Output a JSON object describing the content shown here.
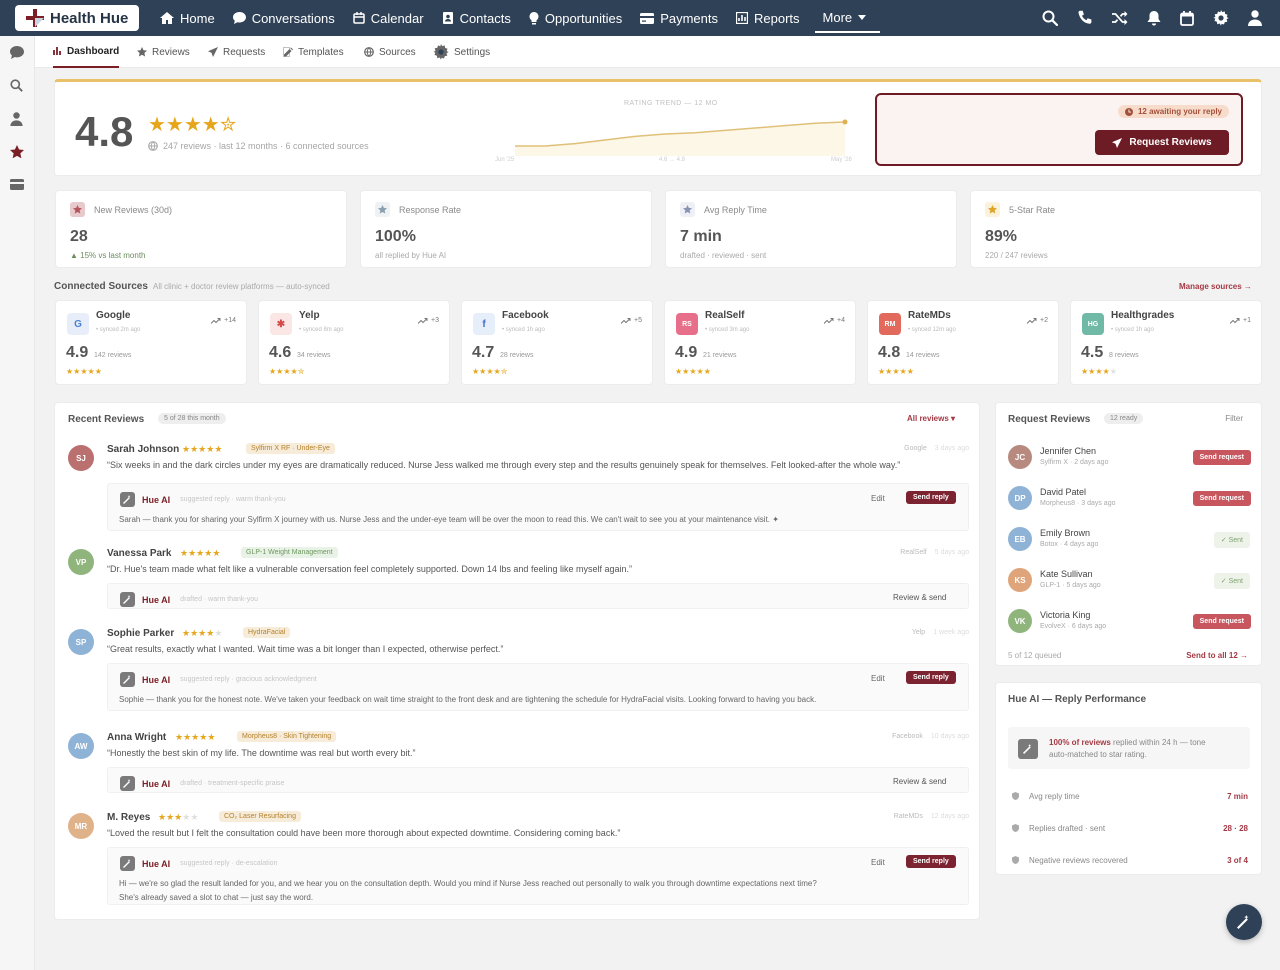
{
  "app": {
    "name": "Health Hue"
  },
  "nav": {
    "links": [
      {
        "label": "Home",
        "icon": "home-icon"
      },
      {
        "label": "Conversations",
        "icon": "chat-icon"
      },
      {
        "label": "Calendar",
        "icon": "calendar-icon"
      },
      {
        "label": "Contacts",
        "icon": "contacts-icon"
      },
      {
        "label": "Opportunities",
        "icon": "lightbulb-icon"
      },
      {
        "label": "Payments",
        "icon": "card-icon"
      },
      {
        "label": "Reports",
        "icon": "chart-icon"
      }
    ],
    "more": "More"
  },
  "subnav": {
    "tabs": [
      {
        "label": "Dashboard",
        "icon": "bar-chart-icon"
      },
      {
        "label": "Reviews",
        "icon": "star-icon"
      },
      {
        "label": "Requests",
        "icon": "send-icon"
      },
      {
        "label": "Templates",
        "icon": "edit-icon"
      },
      {
        "label": "Sources",
        "icon": "globe-icon"
      },
      {
        "label": "Settings",
        "icon": "gear-icon"
      }
    ]
  },
  "hero": {
    "rating": "4.8",
    "meta": "247 reviews · last 12 months · 6 connected sources",
    "trend_title": "RATING TREND — 12 MO",
    "trend_start": "Jun '25",
    "trend_mid": "4.6 → 4.8",
    "trend_end": "May '26",
    "trend_values": [
      4.6,
      4.6,
      4.62,
      4.65,
      4.68,
      4.7,
      4.71,
      4.73,
      4.75,
      4.77,
      4.79,
      4.8
    ],
    "awaiting": "12 awaiting your reply",
    "request_btn": "Request Reviews"
  },
  "kpis": [
    {
      "label": "New Reviews (30d)",
      "value": "28",
      "sub": "▲ 15% vs last month",
      "icon": "inbox-icon",
      "color": "#e8c9cc",
      "fg": "#b35660"
    },
    {
      "label": "Response Rate",
      "value": "100%",
      "sub": "all replied by Hue AI",
      "icon": "reply-icon",
      "color": "#eef2f5",
      "fg": "#8aa0b0"
    },
    {
      "label": "Avg Reply Time",
      "value": "7 min",
      "sub": "drafted · reviewed · sent",
      "icon": "clock-icon",
      "color": "#eef0f6",
      "fg": "#8a93b6"
    },
    {
      "label": "5-Star Rate",
      "value": "89%",
      "sub": "220 / 247 reviews",
      "icon": "star-icon",
      "color": "#fbf2dc",
      "fg": "#e0a42a"
    }
  ],
  "sources_section": {
    "title": "Connected Sources",
    "subtitle": "All clinic + doctor review platforms — auto-synced",
    "manage": "Manage sources →"
  },
  "sources": [
    {
      "name": "Google",
      "sync": "synced 2m ago",
      "trend": "+14",
      "rating": "4.9",
      "count": "142 reviews",
      "stars": 5,
      "logo": "G",
      "bg": "#e7eef9",
      "fg": "#4b82d3"
    },
    {
      "name": "Yelp",
      "sync": "synced 8m ago",
      "trend": "+3",
      "rating": "4.6",
      "count": "34 reviews",
      "stars": 4.5,
      "logo": "✱",
      "bg": "#fbe6e6",
      "fg": "#d34b4b"
    },
    {
      "name": "Facebook",
      "sync": "synced 1h ago",
      "trend": "+5",
      "rating": "4.7",
      "count": "28 reviews",
      "stars": 4.5,
      "logo": "f",
      "bg": "#e6eefa",
      "fg": "#3c6ed1"
    },
    {
      "name": "RealSelf",
      "sync": "synced 3m ago",
      "trend": "+4",
      "rating": "4.9",
      "count": "21 reviews",
      "stars": 5,
      "logo": "RS",
      "bg": "#e86f89",
      "fg": "#fff"
    },
    {
      "name": "RateMDs",
      "sync": "synced 12m ago",
      "trend": "+2",
      "rating": "4.8",
      "count": "14 reviews",
      "stars": 5,
      "logo": "RM",
      "bg": "#e26a5c",
      "fg": "#fff"
    },
    {
      "name": "Healthgrades",
      "sync": "synced 1h ago",
      "trend": "+1",
      "rating": "4.5",
      "count": "8 reviews",
      "stars": 4,
      "logo": "HG",
      "bg": "#6fb9a6",
      "fg": "#fff"
    }
  ],
  "recent": {
    "title": "Recent Reviews",
    "badge": "5 of 28 this month",
    "filter": "All reviews ▾"
  },
  "reviews": [
    {
      "initials": "SJ",
      "avatar": "#b9706f",
      "name": "Sarah Johnson",
      "stars": 5,
      "chip": "Sylfirm X RF · Under-Eye",
      "chipc": "",
      "text": "“Six weeks in and the dark circles under my eyes are dramatically reduced. Nurse Jess walked me through every step and the results genuinely speak for themselves. Felt looked-after the whole way.”",
      "source": "Google",
      "time": "3 days ago",
      "ai_meta": "suggested reply · warm thank-you",
      "actions": "edit",
      "reply": "Sarah — thank you for sharing your Sylfirm X journey with us. Nurse Jess and the under-eye team will be over the moon to read this. We can't wait to see you at your maintenance visit. ✦"
    },
    {
      "initials": "VP",
      "avatar": "#8fb57d",
      "name": "Vanessa Park",
      "stars": 5,
      "chip": "GLP-1 Weight Management",
      "chipc": "green",
      "text": "“Dr. Hue's team made what felt like a vulnerable conversation feel completely supported. Down 14 lbs and feeling like myself again.”",
      "source": "RealSelf",
      "time": "5 days ago",
      "ai_meta": "drafted · warm thank-you",
      "actions": "review",
      "reply": ""
    },
    {
      "initials": "SP",
      "avatar": "#8fb3d6",
      "name": "Sophie Parker",
      "stars": 4,
      "chip": "HydraFacial",
      "chipc": "",
      "text": "“Great results, exactly what I wanted. Wait time was a bit longer than I expected, otherwise perfect.”",
      "source": "Yelp",
      "time": "1 week ago",
      "ai_meta": "suggested reply · gracious acknowledgment",
      "actions": "edit",
      "reply": "Sophie — thank you for the honest note. We've taken your feedback on wait time straight to the front desk and are tightening the schedule for HydraFacial visits. Looking forward to having you back."
    },
    {
      "initials": "AW",
      "avatar": "#8fb3d6",
      "name": "Anna Wright",
      "stars": 5,
      "chip": "Morpheus8 · Skin Tightening",
      "chipc": "",
      "text": "“Honestly the best skin of my life. The downtime was real but worth every bit.”",
      "source": "Facebook",
      "time": "10 days ago",
      "ai_meta": "drafted · treatment-specific praise",
      "actions": "review",
      "reply": ""
    },
    {
      "initials": "MR",
      "avatar": "#e0b28a",
      "name": "M. Reyes",
      "stars": 3,
      "chip": "CO₂ Laser Resurfacing",
      "chipc": "",
      "text": "“Loved the result but I felt the consultation could have been more thorough about expected downtime. Considering coming back.”",
      "source": "RateMDs",
      "time": "12 days ago",
      "ai_meta": "suggested reply · de-escalation",
      "actions": "edit",
      "reply": "Hi — we're so glad the result landed for you, and we hear you on the consultation depth. Would you mind if Nurse Jess reached out personally to walk you through downtime expectations next time?",
      "reply2": "She's already saved a slot to chat — just say the word."
    }
  ],
  "labels": {
    "ai": "Hue AI",
    "edit": "Edit",
    "send": "Send reply",
    "review_send": "Review & send"
  },
  "requests": {
    "title": "Request Reviews",
    "badge": "12 ready",
    "filter": "Filter",
    "footer": "5 of 12 queued",
    "send_all": "Send to all 12 →",
    "send": "Send request",
    "sent": "✓ Sent",
    "items": [
      {
        "initials": "JC",
        "avatar": "#b88a7f",
        "name": "Jennifer Chen",
        "sub": "Sylfirm X · 2 days ago",
        "status": "send"
      },
      {
        "initials": "DP",
        "avatar": "#8fb3d6",
        "name": "David Patel",
        "sub": "Morpheus8 · 3 days ago",
        "status": "send"
      },
      {
        "initials": "EB",
        "avatar": "#8fb3d6",
        "name": "Emily Brown",
        "sub": "Botox · 4 days ago",
        "status": "sent"
      },
      {
        "initials": "KS",
        "avatar": "#e0a47a",
        "name": "Kate Sullivan",
        "sub": "GLP-1 · 5 days ago",
        "status": "sent"
      },
      {
        "initials": "VK",
        "avatar": "#8fb57d",
        "name": "Victoria King",
        "sub": "EvolveX · 6 days ago",
        "status": "send"
      }
    ]
  },
  "perf": {
    "title": "Hue AI — Reply Performance",
    "highlight": "100% of reviews",
    "note": " replied within 24 h — tone",
    "note2": "auto-matched to star rating.",
    "rows": [
      {
        "label": "Avg reply time",
        "value": "7 min"
      },
      {
        "label": "Replies drafted · sent",
        "value": "28 · 28"
      },
      {
        "label": "Negative reviews recovered",
        "value": "3 of 4"
      }
    ]
  }
}
